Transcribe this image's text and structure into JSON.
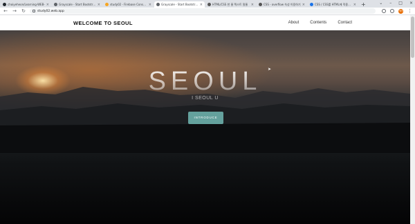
{
  "browser": {
    "tabs": [
      {
        "label": "choiyeheon/Learning-WEB-",
        "color": "#24292f"
      },
      {
        "label": "Grayscale - Start Bootstrap Th",
        "color": "#563d7c"
      },
      {
        "label": "study02 - Firebase Console",
        "color": "#f6a623"
      },
      {
        "label": "Grayscale - Start Bootstrap Th",
        "color": "#5f6368",
        "active": true
      },
      {
        "label": "HTML/CSS 한 줄 텍스트 말줄",
        "color": "#555555"
      },
      {
        "label": "CSS - overflow 속성 이용하기",
        "color": "#555555"
      },
      {
        "label": "CSS / CSS를 HTML에 적용시키",
        "color": "#1a73e8"
      }
    ],
    "new_tab_label": "+",
    "url": "study02.web.app",
    "avatar_initials": "YH"
  },
  "site": {
    "brand": "WELCOME TO SEOUL",
    "nav": [
      "About",
      "Contents",
      "Contact"
    ]
  },
  "hero": {
    "title": "SEOUL",
    "subtitle": "I SEOUL U",
    "button_label": "INTRODUCE",
    "accent_color": "#64a19d"
  }
}
